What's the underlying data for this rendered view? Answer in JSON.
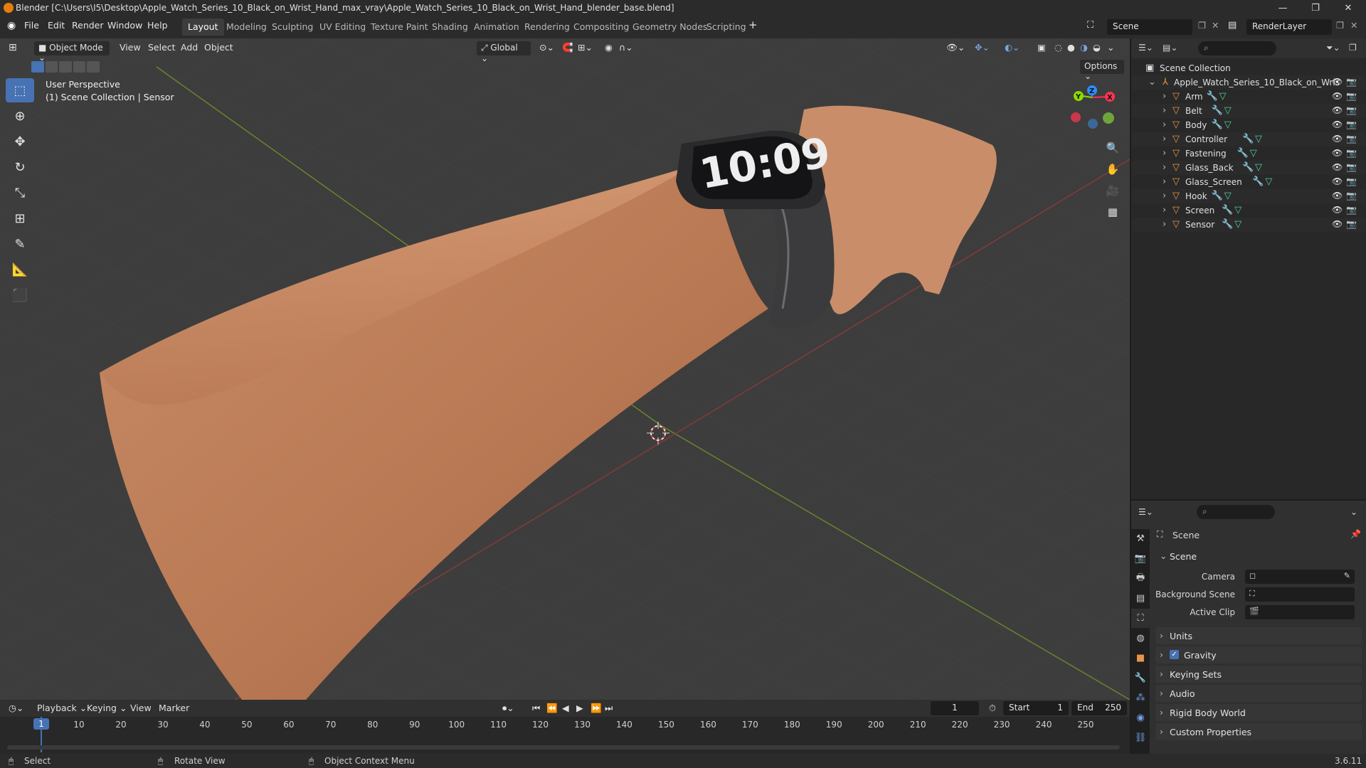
{
  "window": {
    "title": "Blender [C:\\Users\\I5\\Desktop\\Apple_Watch_Series_10_Black_on_Wrist_Hand_max_vray\\Apple_Watch_Series_10_Black_on_Wrist_Hand_blender_base.blend]",
    "minimize": "—",
    "maximize": "❐",
    "close": "✕"
  },
  "menu": {
    "items": [
      "File",
      "Edit",
      "Render",
      "Window",
      "Help"
    ],
    "workspaces": [
      "Layout",
      "Modeling",
      "Sculpting",
      "UV Editing",
      "Texture Paint",
      "Shading",
      "Animation",
      "Rendering",
      "Compositing",
      "Geometry Nodes",
      "Scripting"
    ],
    "add_workspace": "+",
    "scene": "Scene",
    "render_layer": "RenderLayer"
  },
  "viewport": {
    "mode": "Object Mode",
    "menus": [
      "View",
      "Select",
      "Add",
      "Object"
    ],
    "orientation": "Global",
    "options": "Options",
    "info_line1": "User Perspective",
    "info_line2": "(1) Scene Collection | Sensor",
    "gizmo": {
      "x": "X",
      "y": "Y",
      "z": "Z"
    },
    "watch_time": "10:09"
  },
  "outliner": {
    "root": "Scene Collection",
    "collection": "Apple_Watch_Series_10_Black_on_Wris",
    "objects": [
      "Arm",
      "Belt",
      "Body",
      "Controller",
      "Fastening",
      "Glass_Back",
      "Glass_Screen",
      "Hook",
      "Screen",
      "Sensor"
    ]
  },
  "properties": {
    "context": "Scene",
    "panel_scene": "Scene",
    "camera_label": "Camera",
    "background_scene_label": "Background Scene",
    "active_clip_label": "Active Clip",
    "panels": [
      "Units",
      "Gravity",
      "Keying Sets",
      "Audio",
      "Rigid Body World",
      "Custom Properties"
    ],
    "gravity_enabled": true
  },
  "timeline": {
    "menus": [
      "Playback",
      "Keying",
      "View",
      "Marker"
    ],
    "current_frame": "1",
    "start_label": "Start",
    "start": "1",
    "end_label": "End",
    "end": "250",
    "ticks": [
      "1",
      "10",
      "20",
      "30",
      "40",
      "50",
      "60",
      "70",
      "80",
      "90",
      "100",
      "110",
      "120",
      "130",
      "140",
      "150",
      "160",
      "170",
      "180",
      "190",
      "200",
      "210",
      "220",
      "230",
      "240",
      "250"
    ]
  },
  "status": {
    "select": "Select",
    "rotate": "Rotate View",
    "context_menu": "Object Context Menu",
    "version": "3.6.11"
  },
  "colors": {
    "accent": "#4772b3",
    "object_orange": "#e8954a",
    "axis_x": "#ff3352",
    "axis_y": "#8bdc00",
    "axis_z": "#2890ff"
  }
}
